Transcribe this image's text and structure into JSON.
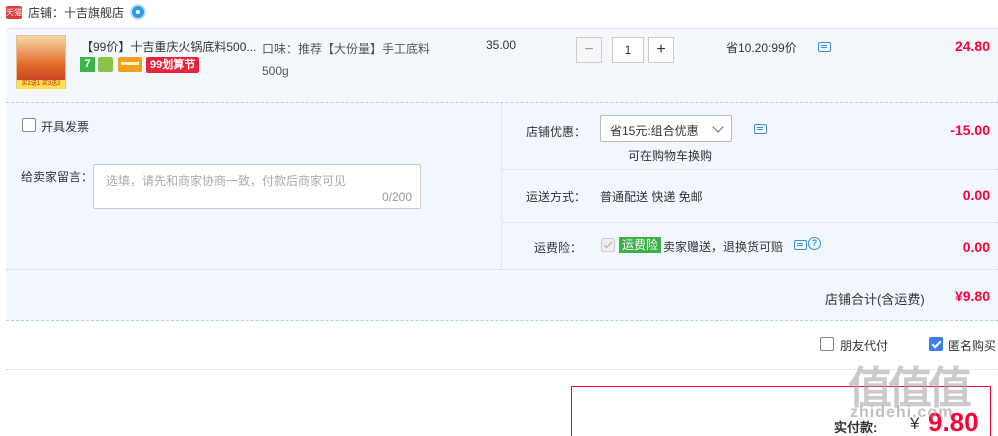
{
  "shop": {
    "badge": "天猫",
    "name": "店铺：十吉旗舰店"
  },
  "item": {
    "image_banner": "买2送1 买3送2",
    "title": "【99价】十吉重庆火锅底料500...",
    "badges": {
      "seven": "7",
      "double99": "99划算节"
    },
    "sku": "口味：推荐【大份量】手工底料500g",
    "unit_price": "35.00",
    "quantity": "1",
    "promo": "省10.20:99价",
    "subtotal": "24.80"
  },
  "invoice": {
    "label": "开具发票"
  },
  "message": {
    "label": "给卖家留言：",
    "placeholder": "选填，请先和商家协商一致，付款后商家可见",
    "count": "0/200"
  },
  "shop_discount": {
    "label": "店铺优惠：",
    "selected": "省15元:组合优惠",
    "note": "可在购物车换购",
    "value": "-15.00"
  },
  "shipping": {
    "label": "运送方式：",
    "value": "普通配送 快递 免邮",
    "cost": "0.00"
  },
  "insurance": {
    "label": "运费险：",
    "badge": "运费险",
    "text": "卖家赠送，退换货可赔",
    "cost": "0.00"
  },
  "shop_total": {
    "label": "店铺合计(含运费)",
    "value": "¥9.80"
  },
  "options": {
    "friend_pay": "朋友代付",
    "anonymous": "匿名购买"
  },
  "payment": {
    "label": "实付款:",
    "currency": "¥",
    "amount": "9.80"
  },
  "watermark": {
    "logo": "值值值",
    "url": "zhidehi.com"
  },
  "colors": {
    "price_red": "#ff0036",
    "panel_bg": "#f2f7ff",
    "tmall_red": "#e4393c",
    "insurance_green": "#3db049",
    "checkbox_blue": "#3d7cf4"
  }
}
